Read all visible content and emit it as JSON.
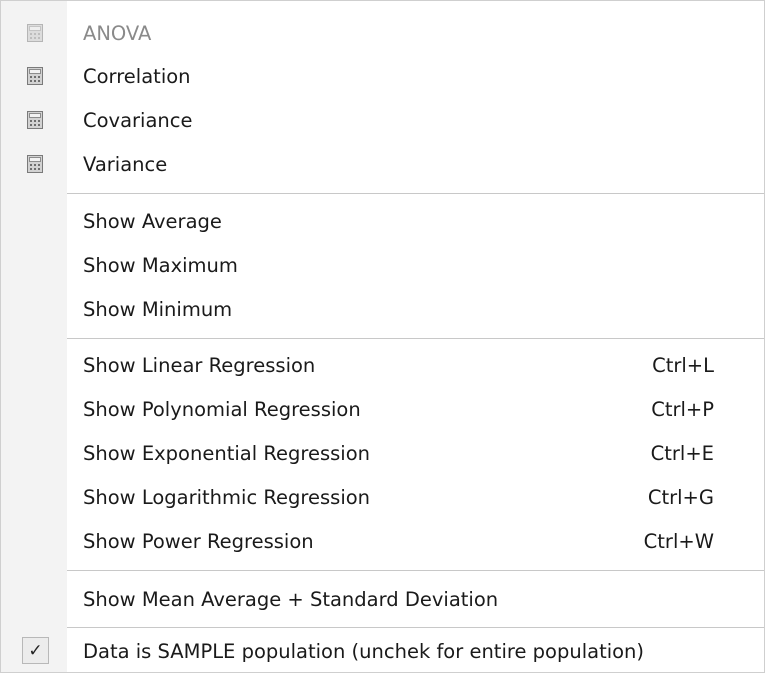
{
  "menu": {
    "items": [
      {
        "label": "ANOVA",
        "icon": "calculator-icon",
        "disabled": true
      },
      {
        "label": "Correlation",
        "icon": "calculator-icon"
      },
      {
        "label": "Covariance",
        "icon": "calculator-icon"
      },
      {
        "label": "Variance",
        "icon": "calculator-icon"
      },
      {
        "label": "Show Average"
      },
      {
        "label": "Show Maximum"
      },
      {
        "label": "Show Minimum"
      },
      {
        "label": "Show Linear Regression",
        "shortcut": "Ctrl+L"
      },
      {
        "label": "Show Polynomial Regression",
        "shortcut": "Ctrl+P"
      },
      {
        "label": "Show Exponential Regression",
        "shortcut": "Ctrl+E"
      },
      {
        "label": "Show Logarithmic Regression",
        "shortcut": "Ctrl+G"
      },
      {
        "label": "Show Power Regression",
        "shortcut": "Ctrl+W"
      },
      {
        "label": "Show Mean Average + Standard Deviation"
      },
      {
        "label": "Data is  SAMPLE population (unchek for entire population)",
        "checked": true,
        "check_glyph": "✓"
      }
    ]
  },
  "colors": {
    "menu_background": "#ffffff",
    "gutter_background": "#f3f3f3",
    "separator": "#c8c8c8",
    "disabled_text": "#8a8a8a"
  }
}
